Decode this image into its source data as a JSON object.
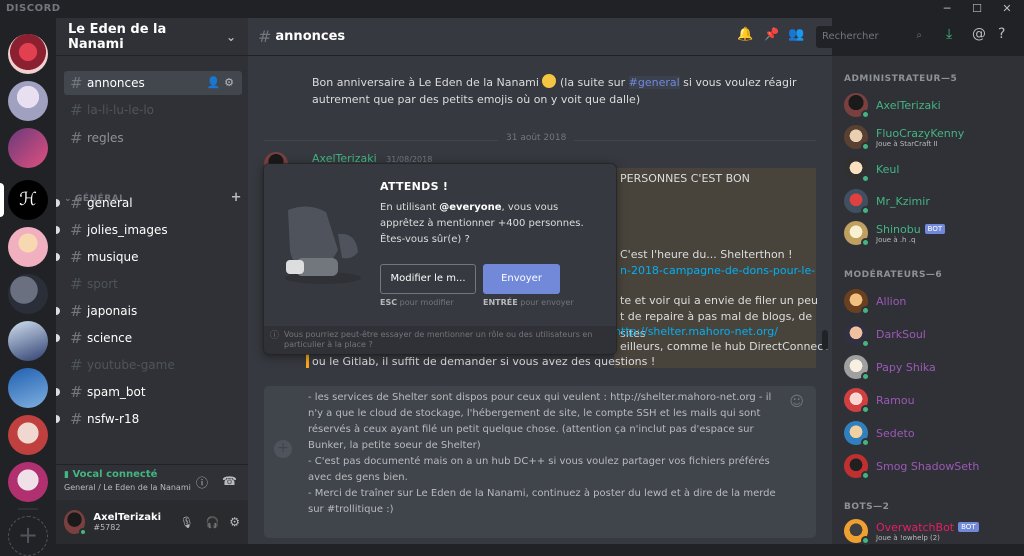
{
  "app": {
    "brand": "DISCORD"
  },
  "window_controls": [
    "─",
    "☐",
    "✕"
  ],
  "server": {
    "name": "Le Eden de la Nanami",
    "chevron": "chevron-down-icon"
  },
  "channels": {
    "top": [
      "annonces",
      "la-li-lu-le-lo",
      "regles"
    ],
    "category": "GÉNÉRAL",
    "general": [
      "general",
      "jolies_images",
      "musique",
      "sport",
      "japonais",
      "science",
      "youtube-game",
      "spam_bot",
      "nsfw-r18"
    ]
  },
  "voice": {
    "status": "Vocal connecté",
    "channel": "General / Le Eden de la Nanami"
  },
  "user": {
    "name": "AxelTerizaki",
    "discriminator": "#5782"
  },
  "header": {
    "channel": "annonces",
    "search_placeholder": "Rechercher"
  },
  "messages": {
    "top_text_1": "Bon anniversaire à Le Eden de la Nanami",
    "top_text_2": "(la suite sur",
    "top_mention": "#general",
    "top_text_3": "si vous voulez réagir autrement",
    "top_text_4": "que par des petits emojis où on y voit que dalle)",
    "date": "31 août 2018",
    "author": "AxelTerizaki",
    "timestamp": "31/08/2018",
    "caps": "PERSONNES C'EST BON",
    "frag1": "C'est l'heure du... Shelterthon !",
    "frag2": "n-2018-campagne-de-dons-pour-le-",
    "frag3": "te et voir qui a envie de filer un peu",
    "frag4": "t de repaire à pas mal de blogs, de sites",
    "frag5": "http://shelter.mahoro-net.org/",
    "frag6": "eilleurs, comme le hub DirectConnect",
    "frag7": "ou le Gitlab, il suffit de demander si vous avez des questions !"
  },
  "composer": {
    "text": "- les services de Shelter sont dispos pour ceux qui veulent : http://shelter.mahoro-net.org - il n'y a que le cloud de stockage, l'hébergement de site, le compte SSH et les mails qui sont réservés à ceux ayant filé un petit quelque chose. (attention ça n'inclut pas d'espace sur Bunker, la petite soeur de Shelter)\n- C'est pas documenté mais on a un hub DC++ si vous voulez partager vos fichiers préférés avec des gens bien.\n- Merci de traîner sur Le Eden de la Nanami, continuez à poster du lewd et à dire de la merde sur #trollitique :)"
  },
  "modal": {
    "title": "ATTENDS !",
    "body_pre": "En utilisant",
    "body_mention": "@everyone",
    "body_post": ", vous vous apprêtez à mentionner +400 personnes. Êtes-vous sûr(e) ?",
    "modify_label": "Modifier le m...",
    "send_label": "Envoyer",
    "hint_esc_key": "ESC",
    "hint_esc": "pour modifier",
    "hint_enter_key": "ENTRÉE",
    "hint_enter": "pour envoyer",
    "footer": "Vous pourriez peut-être essayer de mentionner un rôle ou des utilisateurs en particulier à la place ?"
  },
  "members": {
    "roles": [
      {
        "name": "ADMINISTRATEUR—5",
        "members": [
          {
            "name": "AxelTerizaki",
            "color": "#43b581",
            "sub": ""
          },
          {
            "name": "FluoCrazyKenny",
            "color": "#43b581",
            "sub": "Joue à StarCraft II"
          },
          {
            "name": "Keul",
            "color": "#43b581",
            "sub": ""
          },
          {
            "name": "Mr_Kzimir",
            "color": "#43b581",
            "sub": ""
          },
          {
            "name": "Shinobu",
            "color": "#43b581",
            "sub": "Joue à .h .q",
            "bot": "BOT"
          }
        ]
      },
      {
        "name": "MODÉRATEURS—6",
        "members": [
          {
            "name": "Allion",
            "color": "#9b59b6",
            "sub": ""
          },
          {
            "name": "DarkSoul",
            "color": "#9b59b6",
            "sub": ""
          },
          {
            "name": "Papy Shika",
            "color": "#9b59b6",
            "sub": ""
          },
          {
            "name": "Ramou",
            "color": "#9b59b6",
            "sub": ""
          },
          {
            "name": "Sedeto",
            "color": "#9b59b6",
            "sub": ""
          },
          {
            "name": "Smog ShadowSeth",
            "color": "#9b59b6",
            "sub": ""
          }
        ]
      },
      {
        "name": "BOTS—2",
        "members": [
          {
            "name": "OverwatchBot",
            "color": "#e91e63",
            "sub": "Joue à !owhelp (2)",
            "bot": "BOT"
          }
        ]
      }
    ]
  },
  "colors": {
    "accent": "#7289da",
    "online": "#43b581",
    "admin": "#43b581",
    "moderator": "#9b59b6",
    "bot": "#e91e63"
  }
}
